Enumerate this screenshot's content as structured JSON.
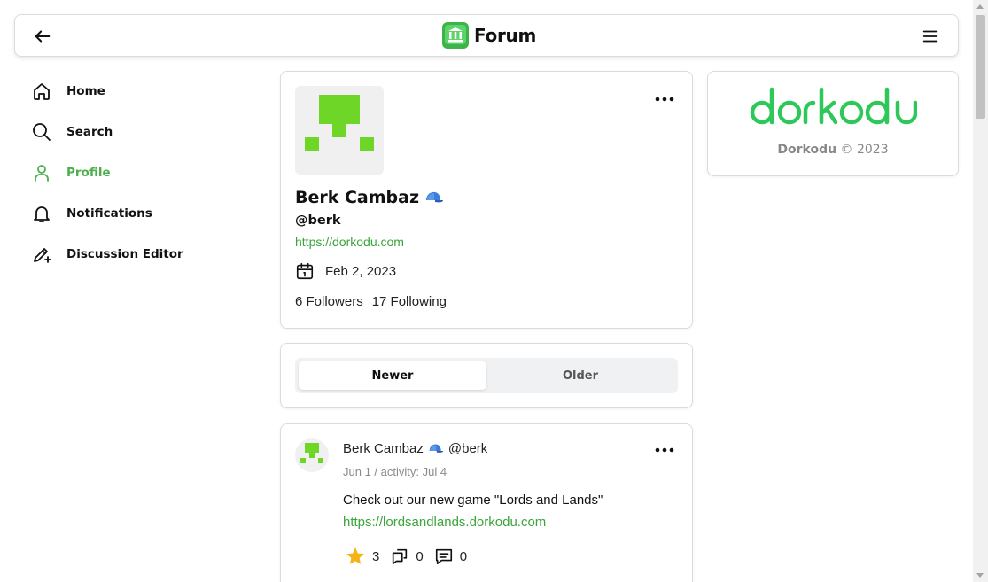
{
  "header": {
    "brand": "Forum",
    "back_icon": "arrow-left-icon",
    "menu_icon": "hamburger-icon",
    "brand_color": "#3bb54a"
  },
  "sidebar": {
    "items": [
      {
        "label": "Home",
        "icon": "home-icon"
      },
      {
        "label": "Search",
        "icon": "search-icon"
      },
      {
        "label": "Profile",
        "icon": "user-icon",
        "active": true
      },
      {
        "label": "Notifications",
        "icon": "bell-icon"
      },
      {
        "label": "Discussion Editor",
        "icon": "pen-plus-icon"
      }
    ],
    "active_color": "#4cae4c"
  },
  "profile": {
    "name": "Berk Cambaz",
    "badge_icon": "cap-icon",
    "handle": "@berk",
    "website": "https://dorkodu.com",
    "joined": "Feb 2, 2023",
    "followers": "6 Followers",
    "following": "17 Following"
  },
  "tabs": {
    "items": [
      "Newer",
      "Older"
    ],
    "active": "Newer"
  },
  "post": {
    "author": "Berk Cambaz",
    "handle": "@berk",
    "meta": "Jun 1 / activity: Jul 4",
    "text": "Check out our new game \"Lords and Lands\"",
    "link": "https://lordsandlands.dorkodu.com",
    "stars": "3",
    "reposts": "0",
    "comments": "0"
  },
  "ad": {
    "logo_text": "dorkodu",
    "brand": "Dorkodu",
    "copyright": "© 2023"
  }
}
